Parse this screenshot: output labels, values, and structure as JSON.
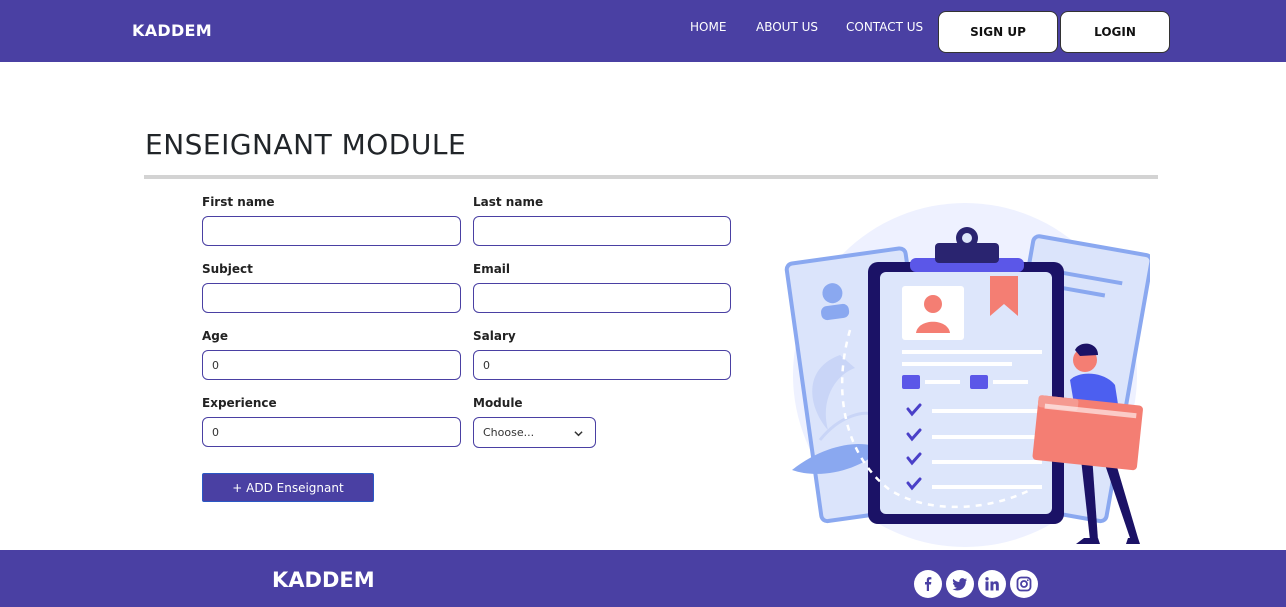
{
  "navbar": {
    "brand": "KADDEM",
    "links": [
      "HOME",
      "ABOUT US",
      "CONTACT US"
    ],
    "signup_label": "SIGN UP",
    "login_label": "LOGIN"
  },
  "page": {
    "title": "ENSEIGNANT MODULE"
  },
  "form": {
    "first_name": {
      "label": "First name",
      "value": ""
    },
    "last_name": {
      "label": "Last name",
      "value": ""
    },
    "subject": {
      "label": "Subject",
      "value": ""
    },
    "email": {
      "label": "Email",
      "value": ""
    },
    "age": {
      "label": "Age",
      "value": "0"
    },
    "salary": {
      "label": "Salary",
      "value": "0"
    },
    "experience": {
      "label": "Experience",
      "value": "0"
    },
    "module": {
      "label": "Module",
      "selected": "Choose..."
    },
    "submit_label": "+ ADD Enseignant"
  },
  "footer": {
    "brand": "KADDEM",
    "social_icons": [
      "facebook-icon",
      "twitter-icon",
      "linkedin-icon",
      "instagram-icon"
    ]
  },
  "colors": {
    "primary": "#4a40a3",
    "accent_coral": "#f47e73",
    "accent_blue": "#8aa8f0",
    "dark_navy": "#1b1266"
  }
}
